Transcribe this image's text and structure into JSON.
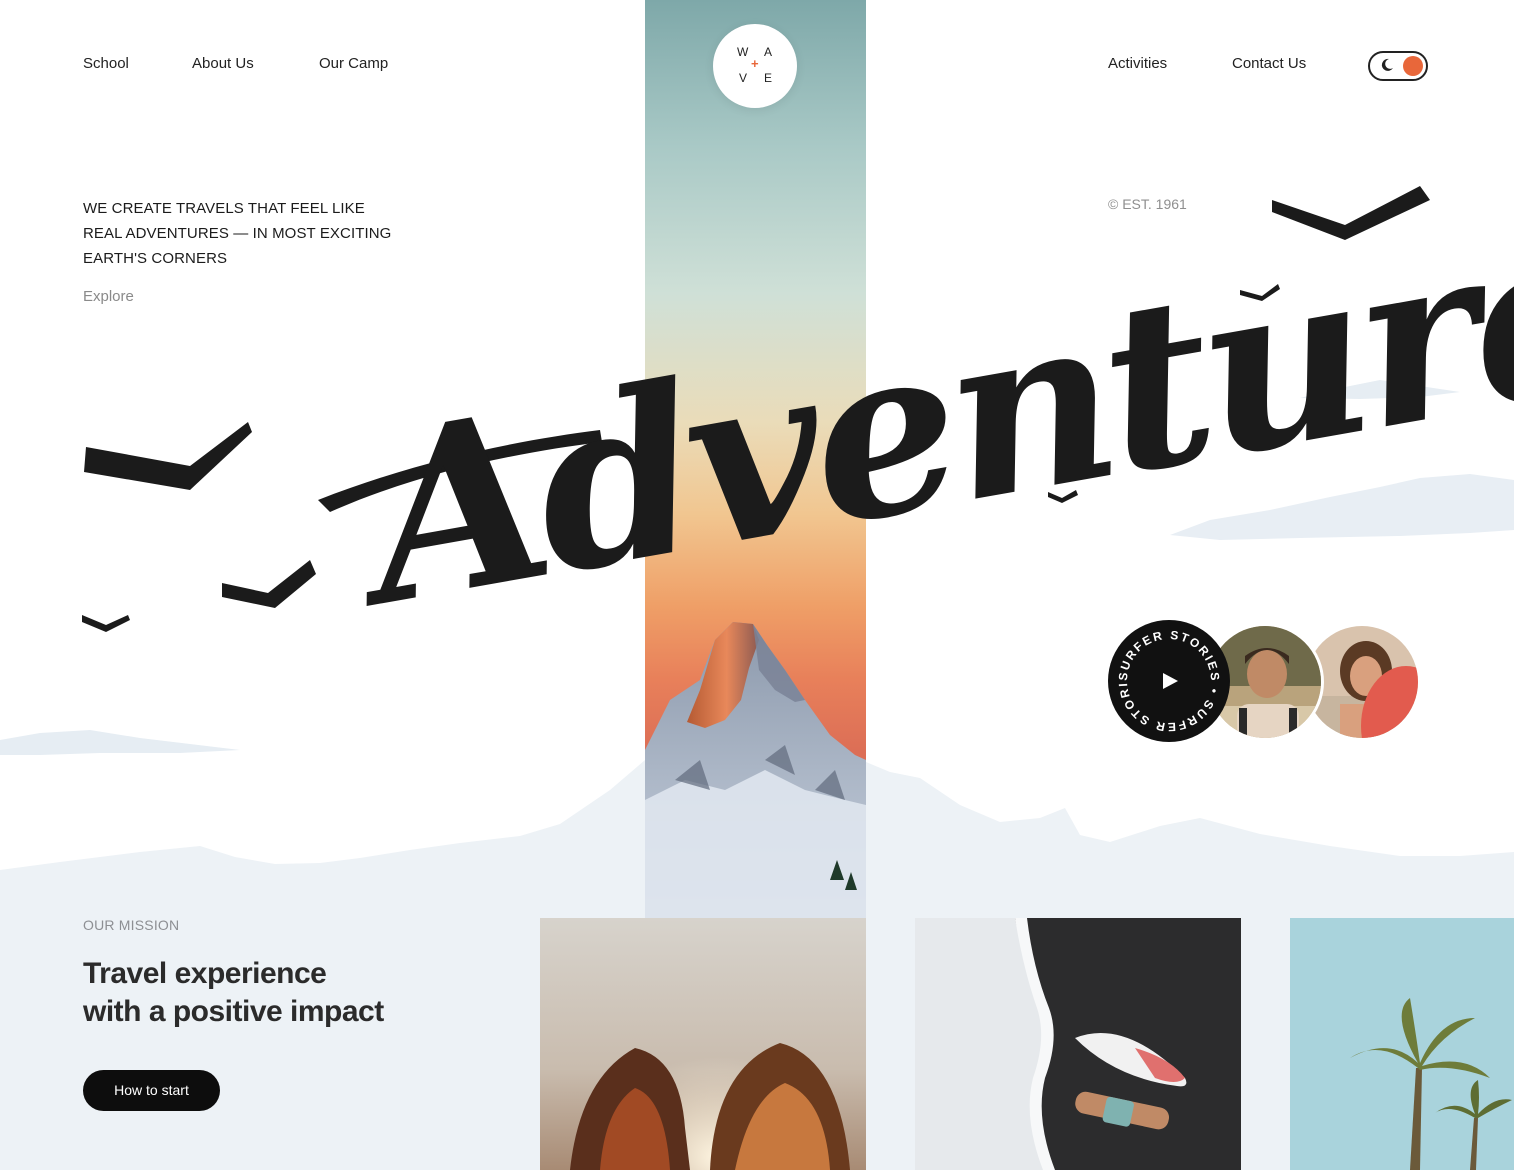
{
  "nav": {
    "left": [
      "School",
      "About  Us",
      "Our Camp"
    ],
    "right": [
      "Activities",
      "Contact Us"
    ]
  },
  "logo": {
    "letters": [
      "W",
      "A",
      "V",
      "E"
    ],
    "plus": "+"
  },
  "theme_toggle": {
    "icons": [
      "moon-icon",
      "sun-icon"
    ],
    "accent": "#e8673a"
  },
  "hero": {
    "tagline": "WE CREATE TRAVELS THAT FEEL LIKE REAL ADVENTURES — IN MOST EXCITING EARTH'S CORNERS",
    "explore_label": "Explore",
    "est_label": "© EST. 1961",
    "headline": "Adventure"
  },
  "stories": {
    "ring_text": "SURFER STORIES • SURFER STORIES • ",
    "play_icon": "play-icon",
    "avatars": [
      "surfer-man-avatar",
      "surfer-woman-avatar"
    ]
  },
  "mission": {
    "label": "OUR MISSION",
    "title_line1": "Travel experience",
    "title_line2": "with a positive impact",
    "cta_label": "How to start"
  },
  "colors": {
    "accent": "#e8673a",
    "text": "#1b1b1b",
    "muted": "#8a8a8a",
    "mountain": "#edf1f5",
    "button": "#0d0d0d"
  }
}
